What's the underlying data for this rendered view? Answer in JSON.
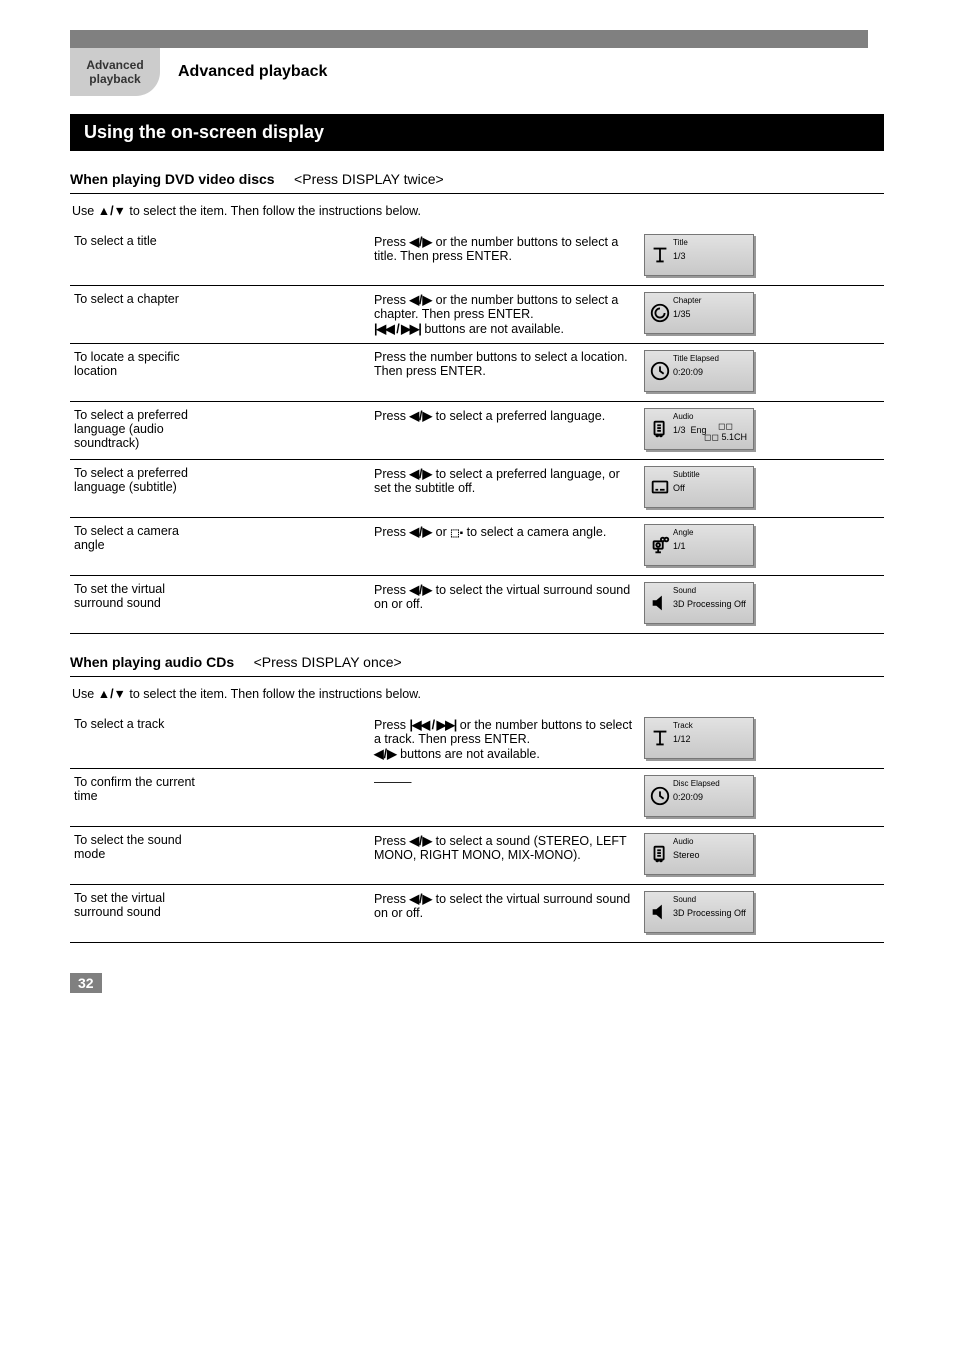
{
  "page_number": "32",
  "tab_text": "Advanced\nplayback",
  "tab_title": "Advanced playback",
  "blackbar": "Using the on-screen display",
  "dvd_section_header_prefix": "When playing DVD video discs",
  "dvd_section_header_suffix": "(Press DISPLAY twice)",
  "subnote_prefix": "Use ",
  "subnote_arrows": "▲/▼",
  "subnote_suffix": " to select the item. Then follow the instructions below.",
  "dvd_rows": [
    {
      "left": "To select a title",
      "mid_prefix": "Press ",
      "mid_sym": "◀/▶",
      "mid_suffix": " or the number buttons to select a title. Then press ENTER.",
      "icon": "title",
      "icon_label": "Title",
      "icon_num": "1/3"
    },
    {
      "left": "To select a chapter",
      "mid_lines": [
        {
          "prefix": "Press ",
          "sym": "◀/▶",
          "suffix": " or the number buttons to select a chapter. Then press ENTER."
        },
        {
          "prefix": "",
          "sym": "|◀◀ / ▶▶|",
          "suffix": " buttons are not available."
        }
      ],
      "icon": "chapter",
      "icon_label": "Chapter",
      "icon_num": "1/35"
    },
    {
      "left": "To locate a specific\nlocation",
      "mid_plain": "Press the number buttons to select a location. Then press ENTER.",
      "icon": "clock",
      "icon_label": "Title Elapsed",
      "icon_num": "0:20:09"
    },
    {
      "left": "To select a preferred\nlanguage (audio\nsoundtrack)",
      "mid_prefix": "Press ",
      "mid_sym": "◀/▶",
      "mid_suffix": " to select a preferred language.",
      "icon": "audio",
      "icon_label": "Audio",
      "icon_num": "1/3  Eng",
      "dolby": "Dolby Digital 5.1CH"
    },
    {
      "left": "To select a preferred\nlanguage (subtitle)",
      "mid_prefix": "Press ",
      "mid_sym": "◀/▶",
      "mid_suffix": " to select a preferred language, or set the subtitle off.",
      "icon": "subtitle",
      "icon_label": "Subtitle",
      "icon_num": "Off"
    },
    {
      "left": "To select a camera\nangle",
      "mid_prefix": "Press ",
      "mid_sym": "◀/▶",
      "mid_suffix_1": " or ",
      "mid_sym_2": "(angle icon)",
      "mid_suffix_2": " to select a camera angle.",
      "icon": "angle",
      "icon_label": "Angle",
      "icon_num": "1/1"
    },
    {
      "left": "To set the virtual\nsurround sound",
      "mid_prefix": "Press ",
      "mid_sym": "◀/▶",
      "mid_suffix": " to select the virtual surround sound on or off.",
      "icon": "sound",
      "icon_label": "Sound",
      "icon_num": "3D Processing Off"
    }
  ],
  "acd_section_header_prefix": "When playing audio CDs",
  "acd_section_header_suffix": "(Press DISPLAY once)",
  "acd_rows": [
    {
      "left": "To select a track",
      "mid_lines": [
        {
          "prefix": "Press ",
          "sym": "|◀◀ / ▶▶|",
          "suffix": " or the number buttons to select a track. Then press ENTER."
        },
        {
          "prefix": "",
          "sym": "◀/▶",
          "suffix": " buttons are not available."
        }
      ],
      "icon": "title",
      "icon_label": "Track",
      "icon_num": "1/12"
    },
    {
      "left": "To confirm the current\ntime",
      "mid_dash": true,
      "icon": "clock",
      "icon_label": "Disc Elapsed",
      "icon_num": "0:20:09"
    },
    {
      "left": "To select the sound\nmode",
      "mid_prefix": "Press ",
      "mid_sym": "◀/▶",
      "mid_suffix": " to select a sound (STEREO, LEFT MONO, RIGHT MONO, MIX-MONO).",
      "icon": "audio",
      "icon_label": "Audio",
      "icon_num": "Stereo"
    },
    {
      "left": "To set the virtual\nsurround sound",
      "mid_prefix": "Press ",
      "mid_sym": "◀/▶",
      "mid_suffix": " to select the virtual surround sound on or off.",
      "icon": "sound",
      "icon_label": "Sound",
      "icon_num": "3D Processing Off"
    }
  ]
}
